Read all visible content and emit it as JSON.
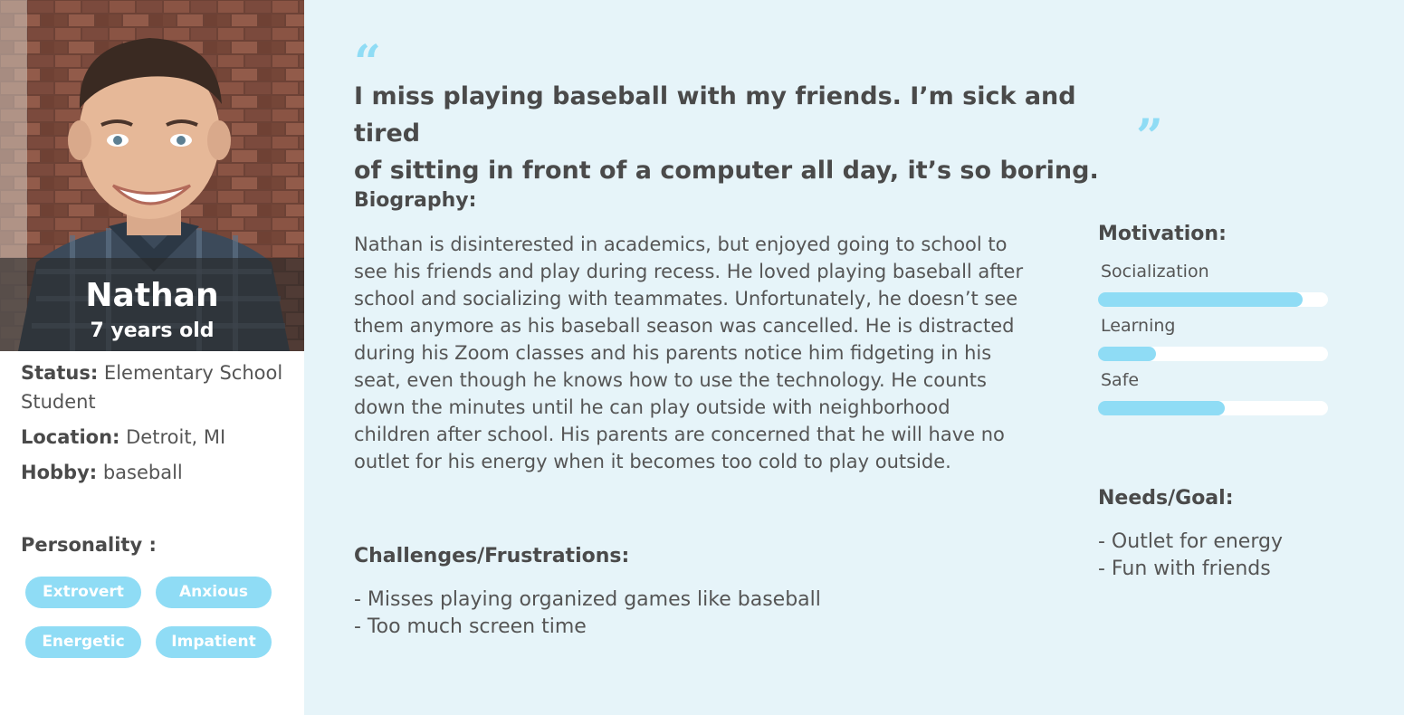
{
  "profile": {
    "name": "Nathan",
    "age": "7 years old",
    "status_label": "Status:",
    "status_value": "Elementary School Student",
    "location_label": "Location:",
    "location_value": "Detroit, MI",
    "hobby_label": "Hobby:",
    "hobby_value": "baseball"
  },
  "personality": {
    "title": "Personality :",
    "traits": [
      "Extrovert",
      "Anxious",
      "Energetic",
      "Impatient"
    ]
  },
  "quote": {
    "open_mark": "“",
    "close_mark": "”",
    "line1": "I miss playing baseball with my friends. I’m sick and tired",
    "line2": "of sitting in front of a computer all day, it’s so boring."
  },
  "biography": {
    "title": "Biography:",
    "text": "Nathan is disinterested in academics, but enjoyed going to school to see his friends and play during recess. He loved playing baseball after school and socializing with teammates. Unfortunately, he doesn’t see them anymore as his baseball season was cancelled. He is distracted during his Zoom classes and his parents notice him fidgeting in his seat, even though he knows how to use the technology. He counts down the minutes until he can play outside with neighborhood children after school. His parents are concerned that he will have no outlet for his energy when it becomes too cold to play outside."
  },
  "challenges": {
    "title": "Challenges/Frustrations:",
    "items": [
      "- Misses playing organized games like baseball",
      "- Too much screen time"
    ]
  },
  "motivation": {
    "title": "Motivation:",
    "items": [
      {
        "label": "Socialization",
        "level": 0.89
      },
      {
        "label": "Learning",
        "level": 0.25
      },
      {
        "label": "Safe",
        "level": 0.55
      }
    ]
  },
  "needs": {
    "title": "Needs/Goal:",
    "items": [
      "- Outlet for energy",
      "- Fun with friends"
    ]
  },
  "colors": {
    "accent": "#8fdcf5",
    "panel_bg": "#e6f4f9",
    "text": "#4a4a4a"
  }
}
